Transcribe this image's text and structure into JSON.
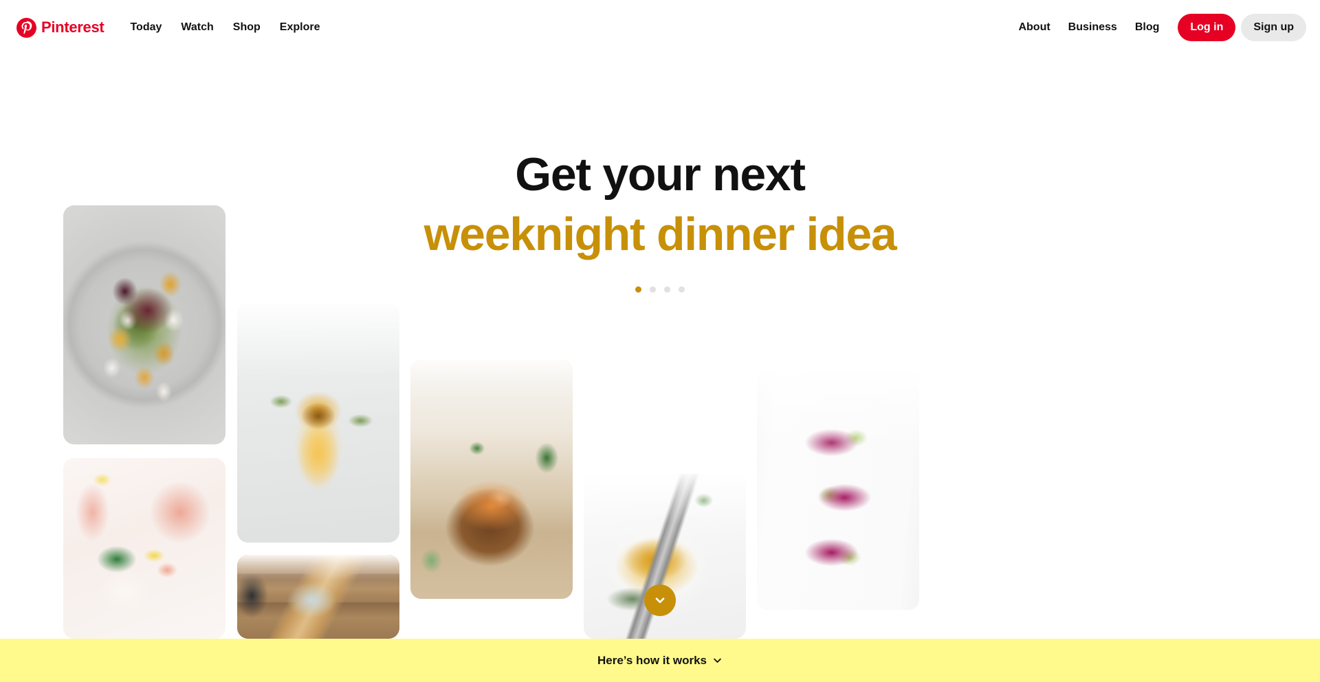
{
  "header": {
    "brand": {
      "logo_icon": "pinterest-p-icon",
      "name": "Pinterest",
      "color": "#e60023"
    },
    "nav_left": [
      {
        "label": "Today"
      },
      {
        "label": "Watch"
      },
      {
        "label": "Shop"
      },
      {
        "label": "Explore"
      }
    ],
    "nav_right": [
      {
        "label": "About"
      },
      {
        "label": "Business"
      },
      {
        "label": "Blog"
      }
    ],
    "login_label": "Log in",
    "signup_label": "Sign up"
  },
  "hero": {
    "line1": "Get your next",
    "line2": "weeknight dinner idea",
    "accent_color": "#c79008",
    "carousel": {
      "total": 4,
      "active_index": 0
    }
  },
  "collage": {
    "pins": [
      {
        "name": "pin-beet-salad",
        "alt": "Beet and goat cheese salad on a grey plate"
      },
      {
        "name": "pin-pink-lemonade",
        "alt": "Pink lemonade with mint and lemon slices"
      },
      {
        "name": "pin-charred-orange-cocktail",
        "alt": "Charred orange cocktail garnished with thyme"
      },
      {
        "name": "pin-rolling-pin",
        "alt": "Rolling pin and blue pot holder on a wooden table"
      },
      {
        "name": "pin-wooden-bowl",
        "alt": "Hands garnishing roasted squash in a wooden bowl"
      },
      {
        "name": "pin-turmeric-hummus",
        "alt": "Turmeric hummus in a white bowl with a fork"
      },
      {
        "name": "pin-beet-toast",
        "alt": "Beet hummus toasts topped with sliced avocado"
      }
    ]
  },
  "scroll_button": {
    "icon": "chevron-down-icon",
    "color": "#c79008"
  },
  "bottom_bar": {
    "label": "Here’s how it works",
    "icon": "chevron-down-icon",
    "background": "#fffa8b"
  }
}
